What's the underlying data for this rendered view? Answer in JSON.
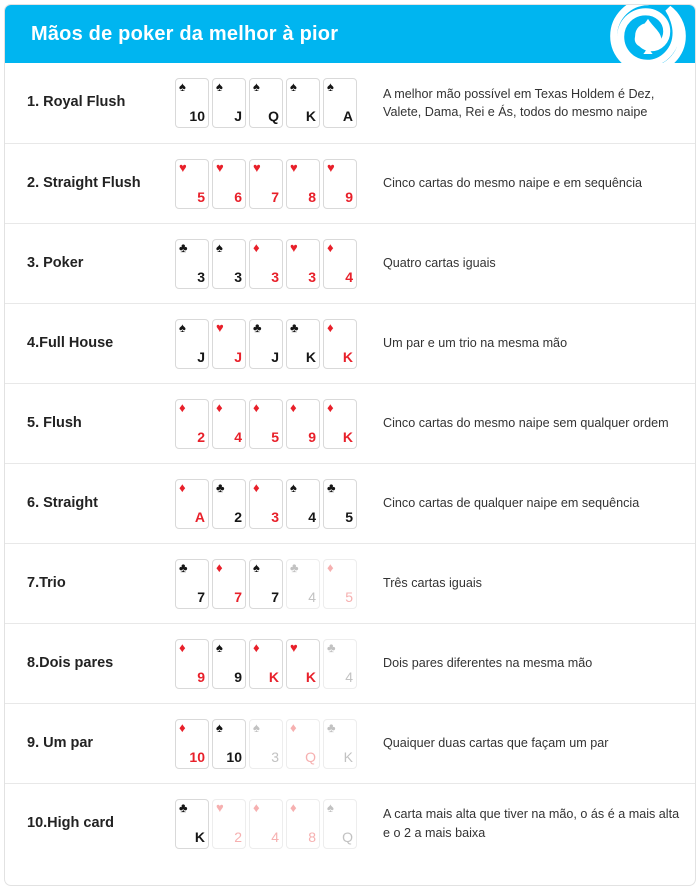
{
  "header": {
    "title": "Mãos de poker da melhor à pior",
    "background_color": "#00B5F0",
    "logo_name": "spade-swirl-logo"
  },
  "colors": {
    "accent": "#00B5F0",
    "red_suit": "#E8202A",
    "black_suit": "#161616",
    "faded_black": "#c2c2c2",
    "faded_red": "#f6b0b0",
    "text": "#333333",
    "border": "#e8e8e8"
  },
  "suit_glyphs": {
    "spade": "♠",
    "heart": "♥",
    "club": "♣",
    "diamond": "♦"
  },
  "rows": [
    {
      "name": "1. Royal Flush",
      "description": "A melhor mão possível em Texas Holdem é Dez, Valete, Dama, Rei e Ás, todos do mesmo naipe",
      "cards": [
        {
          "rank": "10",
          "suit": "spade",
          "color": "black",
          "faded": false
        },
        {
          "rank": "J",
          "suit": "spade",
          "color": "black",
          "faded": false
        },
        {
          "rank": "Q",
          "suit": "spade",
          "color": "black",
          "faded": false
        },
        {
          "rank": "K",
          "suit": "spade",
          "color": "black",
          "faded": false
        },
        {
          "rank": "A",
          "suit": "spade",
          "color": "black",
          "faded": false
        }
      ]
    },
    {
      "name": "2. Straight Flush",
      "description": "Cinco cartas do mesmo naipe e em sequência",
      "cards": [
        {
          "rank": "5",
          "suit": "heart",
          "color": "red",
          "faded": false
        },
        {
          "rank": "6",
          "suit": "heart",
          "color": "red",
          "faded": false
        },
        {
          "rank": "7",
          "suit": "heart",
          "color": "red",
          "faded": false
        },
        {
          "rank": "8",
          "suit": "heart",
          "color": "red",
          "faded": false
        },
        {
          "rank": "9",
          "suit": "heart",
          "color": "red",
          "faded": false
        }
      ]
    },
    {
      "name": "3. Poker",
      "description": "Quatro cartas iguais",
      "cards": [
        {
          "rank": "3",
          "suit": "club",
          "color": "black",
          "faded": false
        },
        {
          "rank": "3",
          "suit": "spade",
          "color": "black",
          "faded": false
        },
        {
          "rank": "3",
          "suit": "diamond",
          "color": "red",
          "faded": false
        },
        {
          "rank": "3",
          "suit": "heart",
          "color": "red",
          "faded": false
        },
        {
          "rank": "4",
          "suit": "diamond",
          "color": "red",
          "faded": false
        }
      ]
    },
    {
      "name": "4.Full House",
      "description": "Um par e um trio na mesma mão",
      "cards": [
        {
          "rank": "J",
          "suit": "spade",
          "color": "black",
          "faded": false
        },
        {
          "rank": "J",
          "suit": "heart",
          "color": "red",
          "faded": false
        },
        {
          "rank": "J",
          "suit": "club",
          "color": "black",
          "faded": false
        },
        {
          "rank": "K",
          "suit": "club",
          "color": "black",
          "faded": false
        },
        {
          "rank": "K",
          "suit": "diamond",
          "color": "red",
          "faded": false
        }
      ]
    },
    {
      "name": "5. Flush",
      "description": "Cinco cartas do mesmo naipe sem qualquer ordem",
      "cards": [
        {
          "rank": "2",
          "suit": "diamond",
          "color": "red",
          "faded": false
        },
        {
          "rank": "4",
          "suit": "diamond",
          "color": "red",
          "faded": false
        },
        {
          "rank": "5",
          "suit": "diamond",
          "color": "red",
          "faded": false
        },
        {
          "rank": "9",
          "suit": "diamond",
          "color": "red",
          "faded": false
        },
        {
          "rank": "K",
          "suit": "diamond",
          "color": "red",
          "faded": false
        }
      ]
    },
    {
      "name": "6. Straight",
      "description": "Cinco cartas de qualquer naipe em sequência",
      "cards": [
        {
          "rank": "A",
          "suit": "diamond",
          "color": "red",
          "faded": false
        },
        {
          "rank": "2",
          "suit": "club",
          "color": "black",
          "faded": false
        },
        {
          "rank": "3",
          "suit": "diamond",
          "color": "red",
          "faded": false
        },
        {
          "rank": "4",
          "suit": "spade",
          "color": "black",
          "faded": false
        },
        {
          "rank": "5",
          "suit": "club",
          "color": "black",
          "faded": false
        }
      ]
    },
    {
      "name": "7.Trio",
      "description": "Três cartas iguais",
      "cards": [
        {
          "rank": "7",
          "suit": "club",
          "color": "black",
          "faded": false
        },
        {
          "rank": "7",
          "suit": "diamond",
          "color": "red",
          "faded": false
        },
        {
          "rank": "7",
          "suit": "spade",
          "color": "black",
          "faded": false
        },
        {
          "rank": "4",
          "suit": "club",
          "color": "black",
          "faded": true
        },
        {
          "rank": "5",
          "suit": "diamond",
          "color": "red",
          "faded": true
        }
      ]
    },
    {
      "name": "8.Dois pares",
      "description": "Dois pares diferentes na mesma mão",
      "cards": [
        {
          "rank": "9",
          "suit": "diamond",
          "color": "red",
          "faded": false
        },
        {
          "rank": "9",
          "suit": "spade",
          "color": "black",
          "faded": false
        },
        {
          "rank": "K",
          "suit": "diamond",
          "color": "red",
          "faded": false
        },
        {
          "rank": "K",
          "suit": "heart",
          "color": "red",
          "faded": false
        },
        {
          "rank": "4",
          "suit": "club",
          "color": "black",
          "faded": true
        }
      ]
    },
    {
      "name": "9. Um par",
      "description": "Quaiquer duas cartas que façam um par",
      "cards": [
        {
          "rank": "10",
          "suit": "diamond",
          "color": "red",
          "faded": false
        },
        {
          "rank": "10",
          "suit": "spade",
          "color": "black",
          "faded": false
        },
        {
          "rank": "3",
          "suit": "spade",
          "color": "black",
          "faded": true
        },
        {
          "rank": "Q",
          "suit": "diamond",
          "color": "red",
          "faded": true
        },
        {
          "rank": "K",
          "suit": "club",
          "color": "black",
          "faded": true
        }
      ]
    },
    {
      "name": "10.High card",
      "description": "A carta mais alta que tiver na mão, o ás é a mais alta e o 2 a mais baixa",
      "cards": [
        {
          "rank": "K",
          "suit": "club",
          "color": "black",
          "faded": false
        },
        {
          "rank": "2",
          "suit": "heart",
          "color": "red",
          "faded": true
        },
        {
          "rank": "4",
          "suit": "diamond",
          "color": "red",
          "faded": true
        },
        {
          "rank": "8",
          "suit": "diamond",
          "color": "red",
          "faded": true
        },
        {
          "rank": "Q",
          "suit": "spade",
          "color": "black",
          "faded": true
        }
      ]
    }
  ]
}
